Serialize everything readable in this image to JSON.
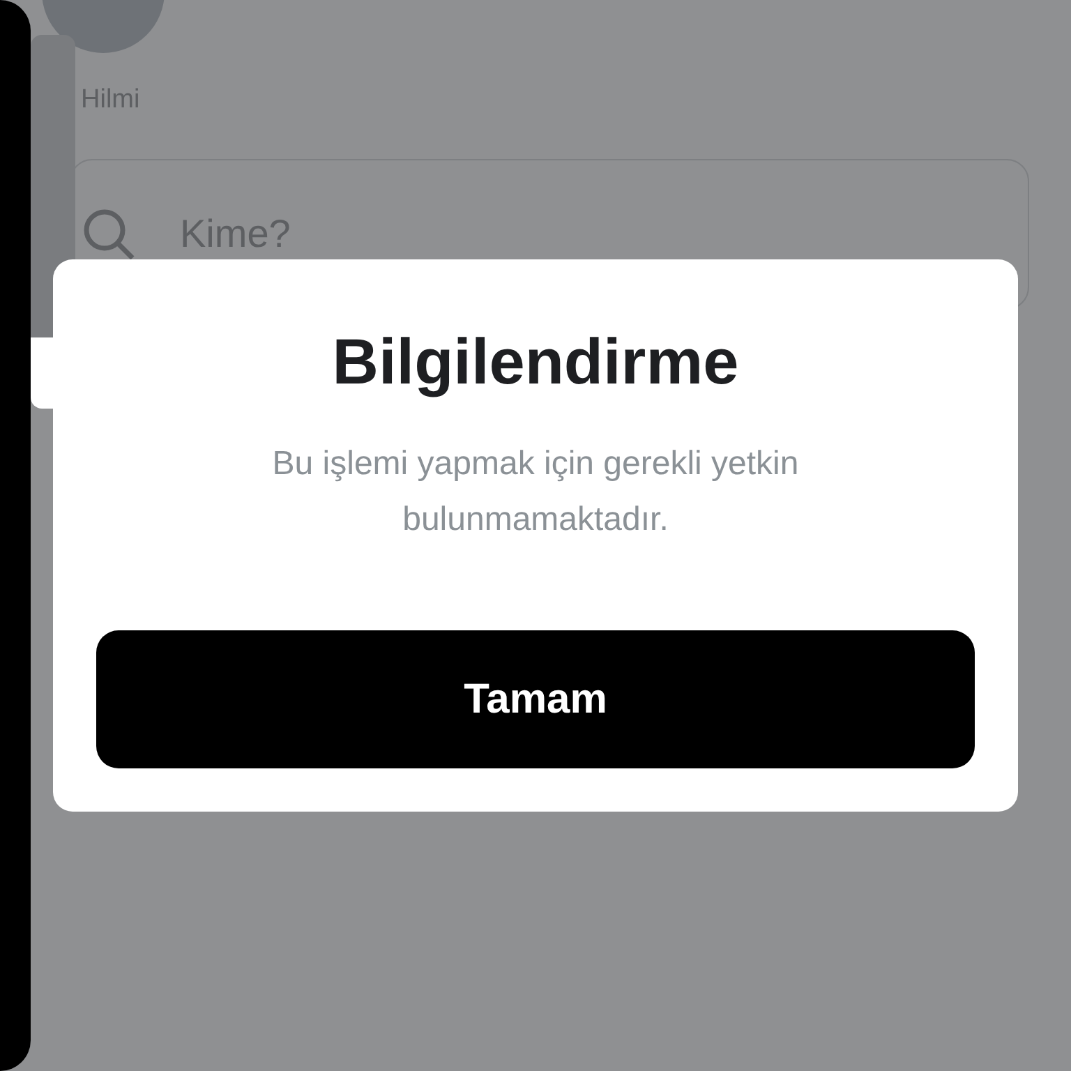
{
  "screen": {
    "user_name": "Hilmi",
    "search": {
      "placeholder": "Kime?"
    }
  },
  "volume_hud": {
    "level": 0.19
  },
  "dialog": {
    "title": "Bilgilendirme",
    "message": "Bu işlemi yapmak için gerekli yetkin bulunmamaktadır.",
    "button": "Tamam"
  }
}
